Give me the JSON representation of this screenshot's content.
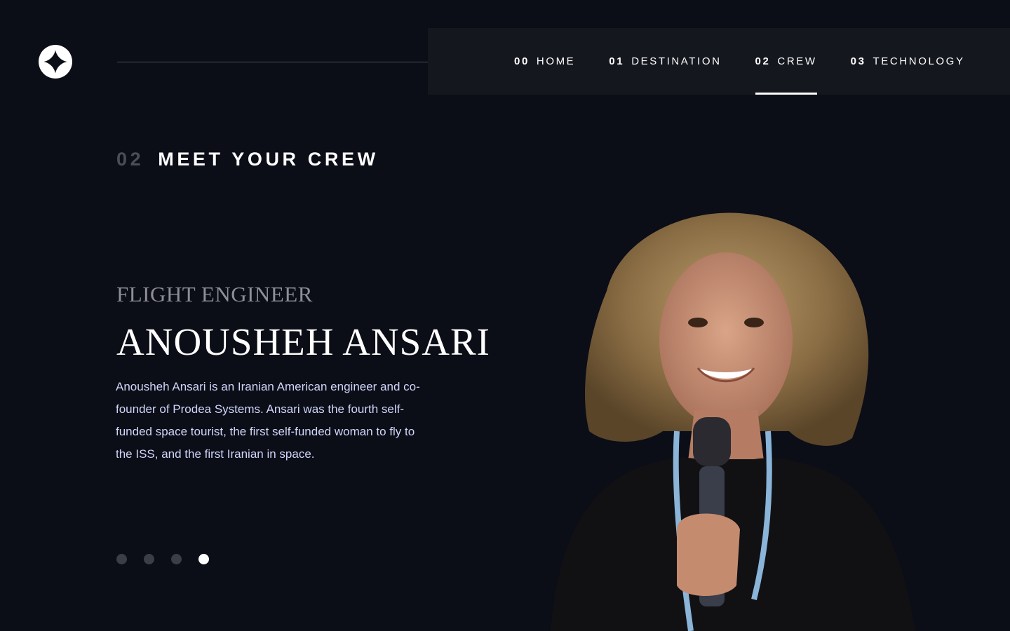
{
  "nav": {
    "items": [
      {
        "num": "00",
        "label": "HOME"
      },
      {
        "num": "01",
        "label": "DESTINATION"
      },
      {
        "num": "02",
        "label": "CREW"
      },
      {
        "num": "03",
        "label": "TECHNOLOGY"
      }
    ],
    "active_index": 2
  },
  "page": {
    "section_num": "02",
    "section_title": "MEET YOUR CREW"
  },
  "crew": {
    "role": "FLIGHT ENGINEER",
    "name": "ANOUSHEH ANSARI",
    "bio": "Anousheh Ansari is an Iranian American engineer and co-founder of Prodea Systems. Ansari was the fourth self-funded space tourist, the first self-funded woman to fly to the ISS, and the first Iranian in space."
  },
  "slider": {
    "count": 4,
    "active_index": 3
  },
  "icons": {
    "logo": "star-logo-icon"
  },
  "colors": {
    "background": "#0b0d17",
    "nav_background": "#15171f",
    "body_text": "#d0d6f9",
    "muted": "#8e8f96"
  }
}
